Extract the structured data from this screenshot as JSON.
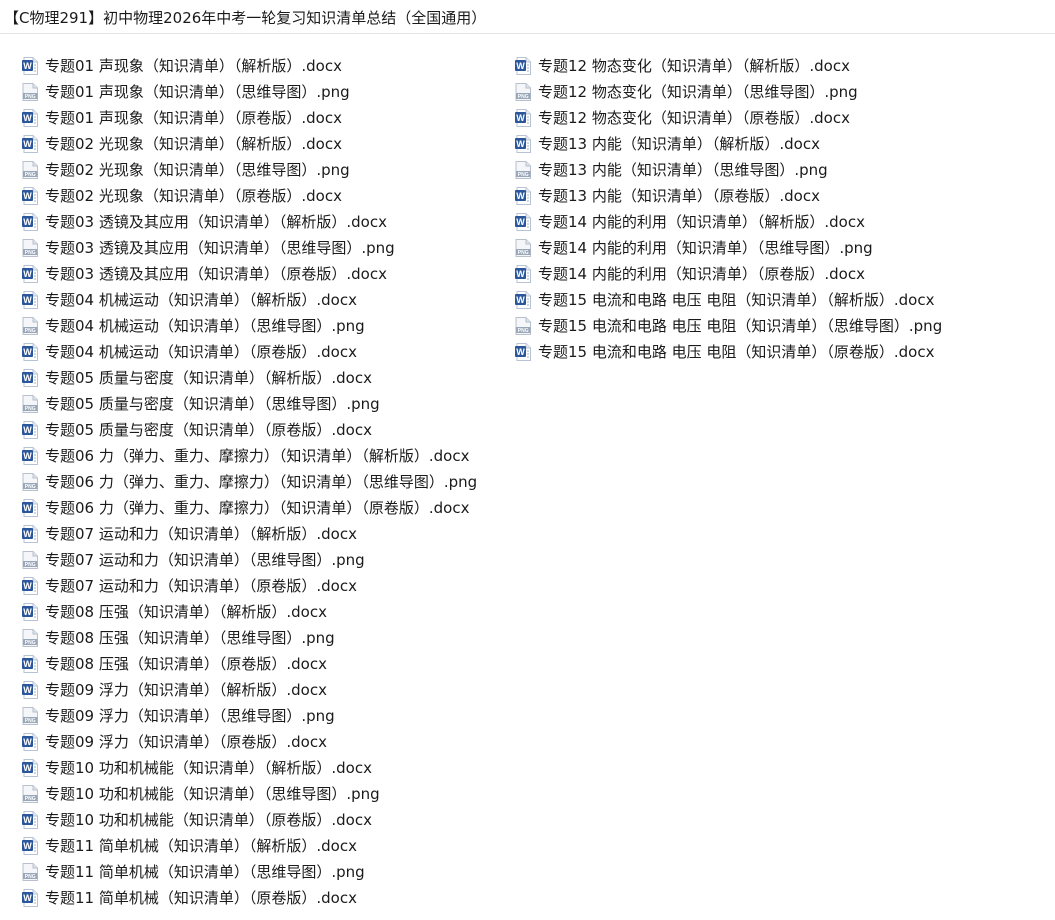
{
  "window": {
    "title": "【C物理291】初中物理2026年中考一轮复习知识清单总结（全国通用）"
  },
  "columns": [
    {
      "files": [
        {
          "name": "专题01 声现象（知识清单）（解析版）.docx",
          "type": "word"
        },
        {
          "name": "专题01 声现象（知识清单）（思维导图）.png",
          "type": "png"
        },
        {
          "name": "专题01 声现象（知识清单）（原卷版）.docx",
          "type": "word"
        },
        {
          "name": "专题02 光现象（知识清单）（解析版）.docx",
          "type": "word"
        },
        {
          "name": "专题02 光现象（知识清单）（思维导图）.png",
          "type": "png"
        },
        {
          "name": "专题02 光现象（知识清单）（原卷版）.docx",
          "type": "word"
        },
        {
          "name": "专题03 透镜及其应用（知识清单）（解析版）.docx",
          "type": "word"
        },
        {
          "name": "专题03 透镜及其应用（知识清单）（思维导图）.png",
          "type": "png"
        },
        {
          "name": "专题03 透镜及其应用（知识清单）（原卷版）.docx",
          "type": "word"
        },
        {
          "name": "专题04 机械运动（知识清单）（解析版）.docx",
          "type": "word"
        },
        {
          "name": "专题04 机械运动（知识清单）（思维导图）.png",
          "type": "png"
        },
        {
          "name": "专题04 机械运动（知识清单）（原卷版）.docx",
          "type": "word"
        },
        {
          "name": "专题05 质量与密度（知识清单）（解析版）.docx",
          "type": "word"
        },
        {
          "name": "专题05 质量与密度（知识清单）（思维导图）.png",
          "type": "png"
        },
        {
          "name": "专题05 质量与密度（知识清单）（原卷版）.docx",
          "type": "word"
        },
        {
          "name": "专题06 力（弹力、重力、摩擦力）（知识清单）（解析版）.docx",
          "type": "word"
        },
        {
          "name": "专题06 力（弹力、重力、摩擦力）（知识清单）（思维导图）.png",
          "type": "png"
        },
        {
          "name": "专题06 力（弹力、重力、摩擦力）（知识清单）（原卷版）.docx",
          "type": "word"
        },
        {
          "name": "专题07 运动和力（知识清单）（解析版）.docx",
          "type": "word"
        },
        {
          "name": "专题07 运动和力（知识清单）（思维导图）.png",
          "type": "png"
        },
        {
          "name": "专题07 运动和力（知识清单）（原卷版）.docx",
          "type": "word"
        },
        {
          "name": "专题08 压强（知识清单）（解析版）.docx",
          "type": "word"
        },
        {
          "name": "专题08 压强（知识清单）（思维导图）.png",
          "type": "png"
        },
        {
          "name": "专题08 压强（知识清单）（原卷版）.docx",
          "type": "word"
        },
        {
          "name": "专题09 浮力（知识清单）（解析版）.docx",
          "type": "word"
        },
        {
          "name": "专题09 浮力（知识清单）（思维导图）.png",
          "type": "png"
        },
        {
          "name": "专题09 浮力（知识清单）（原卷版）.docx",
          "type": "word"
        },
        {
          "name": "专题10 功和机械能（知识清单）（解析版）.docx",
          "type": "word"
        },
        {
          "name": "专题10 功和机械能（知识清单）（思维导图）.png",
          "type": "png"
        },
        {
          "name": "专题10 功和机械能（知识清单）（原卷版）.docx",
          "type": "word"
        },
        {
          "name": "专题11 简单机械（知识清单）（解析版）.docx",
          "type": "word"
        },
        {
          "name": "专题11 简单机械（知识清单）（思维导图）.png",
          "type": "png"
        },
        {
          "name": "专题11 简单机械（知识清单）（原卷版）.docx",
          "type": "word"
        }
      ]
    },
    {
      "files": [
        {
          "name": "专题12 物态变化（知识清单）（解析版）.docx",
          "type": "word"
        },
        {
          "name": "专题12 物态变化（知识清单）（思维导图）.png",
          "type": "png"
        },
        {
          "name": "专题12 物态变化（知识清单）（原卷版）.docx",
          "type": "word"
        },
        {
          "name": "专题13 内能（知识清单）（解析版）.docx",
          "type": "word"
        },
        {
          "name": "专题13 内能（知识清单）（思维导图）.png",
          "type": "png"
        },
        {
          "name": "专题13 内能（知识清单）（原卷版）.docx",
          "type": "word"
        },
        {
          "name": "专题14 内能的利用（知识清单）（解析版）.docx",
          "type": "word"
        },
        {
          "name": "专题14 内能的利用（知识清单）（思维导图）.png",
          "type": "png"
        },
        {
          "name": "专题14 内能的利用（知识清单）（原卷版）.docx",
          "type": "word"
        },
        {
          "name": "专题15 电流和电路 电压 电阻（知识清单）（解析版）.docx",
          "type": "word"
        },
        {
          "name": "专题15 电流和电路 电压 电阻（知识清单）（思维导图）.png",
          "type": "png"
        },
        {
          "name": "专题15 电流和电路 电压 电阻（知识清单）（原卷版）.docx",
          "type": "word"
        }
      ]
    }
  ],
  "icons": {
    "word": {
      "name": "word-doc-icon",
      "color": "#2b579a",
      "glyph": "W"
    },
    "png": {
      "name": "png-image-icon",
      "color": "#9aa7b8",
      "glyph": "PNG"
    }
  }
}
